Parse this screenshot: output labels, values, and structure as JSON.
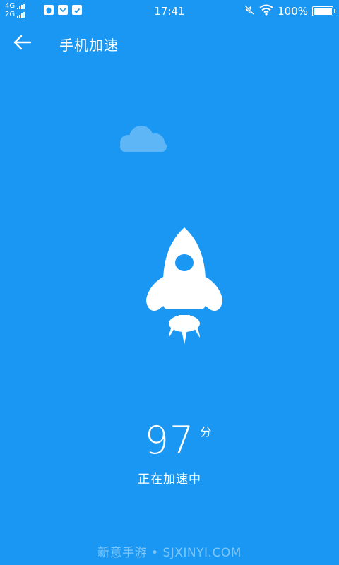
{
  "statusbar": {
    "network_1": "4G",
    "network_2": "2G",
    "time": "17:41",
    "battery": "100%",
    "battery_level": 1.0,
    "icons": [
      "qq-icon",
      "mail-icon",
      "check-icon",
      "mute-icon",
      "wifi-icon",
      "battery-icon"
    ]
  },
  "header": {
    "back_icon": "arrow-left-icon",
    "title": "手机加速"
  },
  "main": {
    "score": "97",
    "score_unit": "分",
    "status_text": "正在加速中",
    "illustration": [
      "cloud-icon",
      "rocket-icon"
    ]
  },
  "watermark": "新意手游 • SJXINYI.COM",
  "colors": {
    "background": "#1997f3",
    "foreground": "#ffffff",
    "cloud": "#5fb6f7"
  }
}
